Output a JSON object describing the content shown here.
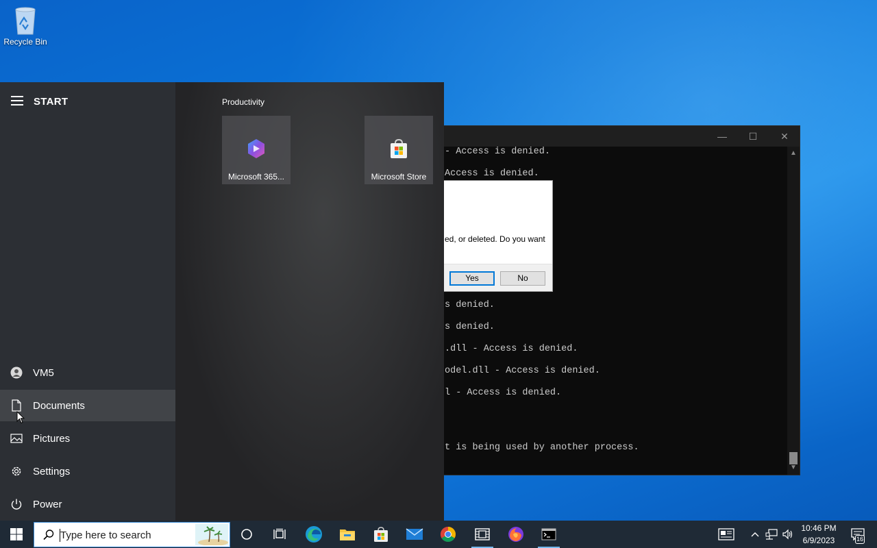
{
  "desktop": {
    "icons": [
      {
        "label": "Recycle Bin",
        "icon": "recycle-bin-icon"
      }
    ]
  },
  "console": {
    "lines": [
      "- Access is denied.",
      "Access is denied.",
      "s denied.",
      "s denied.",
      ".dll - Access is denied.",
      "odel.dll - Access is denied.",
      "l - Access is denied.",
      "t is being used by another process."
    ],
    "controls": {
      "minimize": "—",
      "maximize": "☐",
      "close": "✕"
    }
  },
  "dialog": {
    "message": "ed, or deleted. Do you want",
    "yes_label": "Yes",
    "no_label": "No"
  },
  "start_menu": {
    "title": "START",
    "group_title": "Productivity",
    "tiles": [
      {
        "label": "Microsoft 365...",
        "icon": "microsoft-365-icon"
      },
      {
        "label": "Microsoft Store",
        "icon": "microsoft-store-icon"
      }
    ],
    "rail": [
      {
        "label": "VM5",
        "icon": "user-icon"
      },
      {
        "label": "Documents",
        "icon": "document-icon"
      },
      {
        "label": "Pictures",
        "icon": "pictures-icon"
      },
      {
        "label": "Settings",
        "icon": "gear-icon"
      },
      {
        "label": "Power",
        "icon": "power-icon"
      }
    ]
  },
  "taskbar": {
    "search_placeholder": "Type here to search",
    "apps": [
      {
        "name": "cortana",
        "icon": "cortana-icon"
      },
      {
        "name": "task-view",
        "icon": "task-view-icon"
      },
      {
        "name": "edge",
        "icon": "edge-icon"
      },
      {
        "name": "file-explorer",
        "icon": "folder-icon"
      },
      {
        "name": "microsoft-store",
        "icon": "store-icon"
      },
      {
        "name": "mail",
        "icon": "mail-icon"
      },
      {
        "name": "chrome",
        "icon": "chrome-icon"
      },
      {
        "name": "media",
        "icon": "film-icon"
      },
      {
        "name": "firefox",
        "icon": "firefox-icon"
      },
      {
        "name": "command-prompt",
        "icon": "terminal-icon"
      }
    ],
    "tray": {
      "time": "10:46 PM",
      "date": "6/9/2023",
      "notification_count": "16"
    }
  },
  "colors": {
    "accent": "#0078d7",
    "taskbar": "#1f2a36",
    "start_bg": "#2c3034"
  }
}
